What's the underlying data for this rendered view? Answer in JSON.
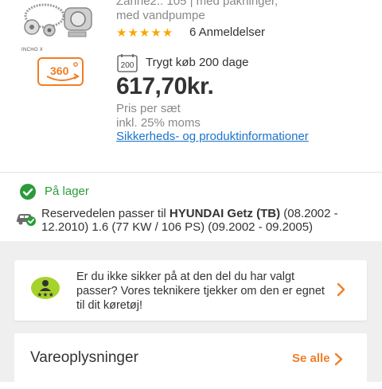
{
  "product": {
    "subtitle_line1": "Zähne2.: 105 | med pakninger,",
    "subtitle_line2": "med vandpumpe",
    "stars": "★★★★★",
    "reviews": "6 Anmeldelser",
    "return_badge": "200",
    "return_text": "Trygt køb 200 dage",
    "price": "617,70kr.",
    "price_unit": "Pris per sæt",
    "vat_note": "inkl. 25% moms",
    "safety_link": "Sikkerheds- og produktinformationer",
    "brand_label": "INCHO X",
    "badge_360": "360",
    "star_color": "#f7a800",
    "accent": "#f07e26",
    "link_color": "#1a73c9"
  },
  "stock": {
    "status": "På lager",
    "status_color": "#2b9b3a",
    "fit_prefix": "Reservedelen passer til ",
    "fit_vehicle": "HYUNDAI Getz (TB)",
    "fit_suffix": " (08.2002 - 12.2010) 1.6 (77 KW / 106 PS) (09.2002 - 09.2005)"
  },
  "help_card": {
    "text": "Er du ikke sikker på at den del du har valgt passer? Vores teknikere tjekker om den er egnet til dit køretøj!"
  },
  "info_card": {
    "title": "Vareoplysninger",
    "see_all": "Se alle"
  }
}
